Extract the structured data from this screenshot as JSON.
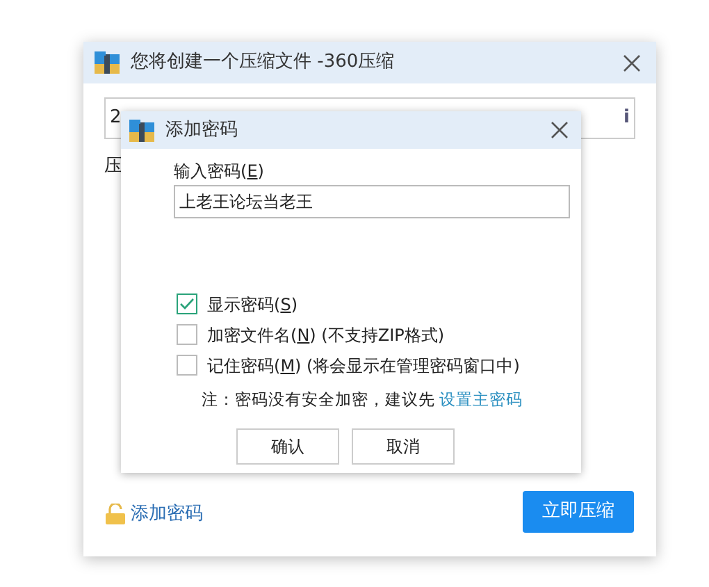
{
  "window": {
    "title": "您将创建一个压缩文件 -360压缩",
    "path_field_value": "2",
    "path_field_button": "i",
    "label_partial": "压",
    "add_password_link": "添加密码",
    "compress_button": "立即压缩"
  },
  "dialog": {
    "title": "添加密码",
    "password_label": [
      "输入密码(",
      "E",
      ")"
    ],
    "password_value": "上老王论坛当老王",
    "options": [
      {
        "label": [
          "显示密码(",
          "S",
          ")"
        ],
        "checked": true
      },
      {
        "label": [
          "加密文件名(",
          "N",
          ")"
        ],
        "note": "(不支持ZIP格式)",
        "checked": false
      },
      {
        "label": [
          "记住密码(",
          "M",
          ")"
        ],
        "note": "(将会显示在管理密码窗口中)",
        "checked": false
      }
    ],
    "hint": "注：密码没有安全加密，建议先",
    "hint_link": "设置主密码",
    "buttons": [
      "确认",
      "取消"
    ]
  }
}
